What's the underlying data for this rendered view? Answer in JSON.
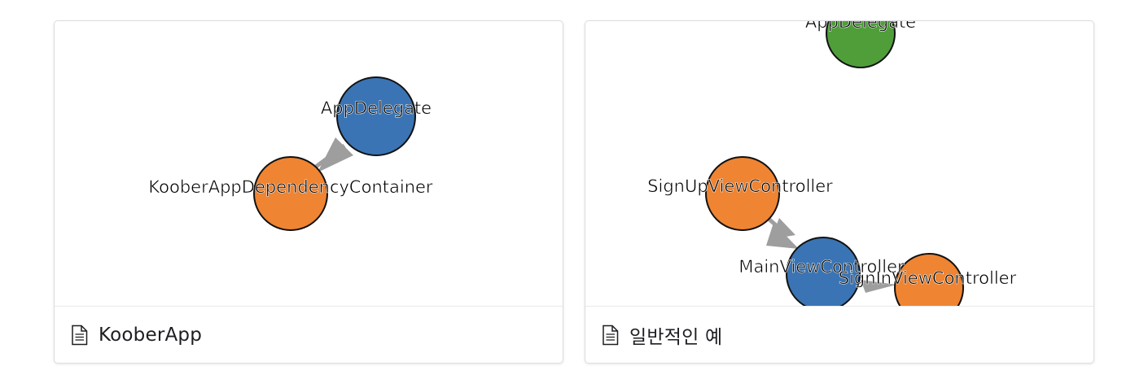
{
  "colors": {
    "node_blue": "#3a74b4",
    "node_orange": "#ef8432",
    "node_green": "#4f9e3a",
    "edge": "#9e9e9e"
  },
  "cards": [
    {
      "title": "KooberApp",
      "icon": "document-icon",
      "nodes": {
        "app_delegate": "AppDelegate",
        "koober_container": "KooberAppDependencyContainer"
      }
    },
    {
      "title": "일반적인 예",
      "icon": "document-icon",
      "nodes": {
        "app_delegate": "AppDelegate",
        "sign_up": "SignUpViewController",
        "main": "MainViewController",
        "sign_in": "SignInViewController"
      }
    }
  ]
}
